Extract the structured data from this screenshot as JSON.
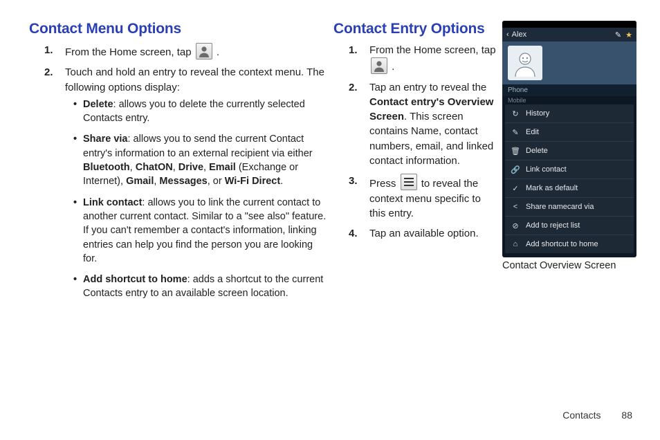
{
  "leftHeading": "Contact Menu Options",
  "leftSteps": {
    "s1a": "From the Home screen, tap",
    "s1b": ".",
    "s2a": "Touch and hold an entry to reveal the context menu. The following options display:"
  },
  "leftBullets": {
    "b1_label": "Delete",
    "b1_text": ": allows you to delete the currently selected Contacts entry.",
    "b2_label": "Share via",
    "b2_t1": ": allows you to send the current Contact entry's information to an external recipient via either ",
    "b2_bt": "Bluetooth",
    "b2_c1": ", ",
    "b2_ch": "ChatON",
    "b2_c2": ", ",
    "b2_dr": "Drive",
    "b2_c3": ", ",
    "b2_em": "Email",
    "b2_t2": " (Exchange or Internet), ",
    "b2_gm": "Gmail",
    "b2_c4": ", ",
    "b2_ms": "Messages",
    "b2_t3": ", or ",
    "b2_wi": "Wi-Fi Direct",
    "b2_end": ".",
    "b3_label": "Link contact",
    "b3_text": ": allows you to link the current contact to another current contact. Similar to a \"see also\" feature. If you can't remember a contact's information, linking entries can help you find the person you are looking for.",
    "b4_label": "Add shortcut to home",
    "b4_text": ": adds a shortcut to the current Contacts entry to an available screen location."
  },
  "rightHeading": "Contact Entry Options",
  "rightSteps": {
    "s1a": "From the Home screen, tap",
    "s1b": ".",
    "s2a": "Tap an entry to reveal the ",
    "s2b": "Contact entry's Overview Screen",
    "s2c": ". This screen contains Name, contact numbers, email, and linked contact information.",
    "s3a": "Press",
    "s3b": "to reveal the context menu specific to this entry.",
    "s4": "Tap an available option."
  },
  "phone": {
    "title_name": "Alex",
    "section_phone": "Phone",
    "mobile_label": "Mobile",
    "menu": {
      "history": "History",
      "edit": "Edit",
      "delete": "Delete",
      "link": "Link contact",
      "default": "Mark as default",
      "share": "Share namecard via",
      "reject": "Add to reject list",
      "shortcut": "Add shortcut to home"
    },
    "caption": "Contact Overview Screen"
  },
  "footer": {
    "section": "Contacts",
    "page": "88"
  }
}
